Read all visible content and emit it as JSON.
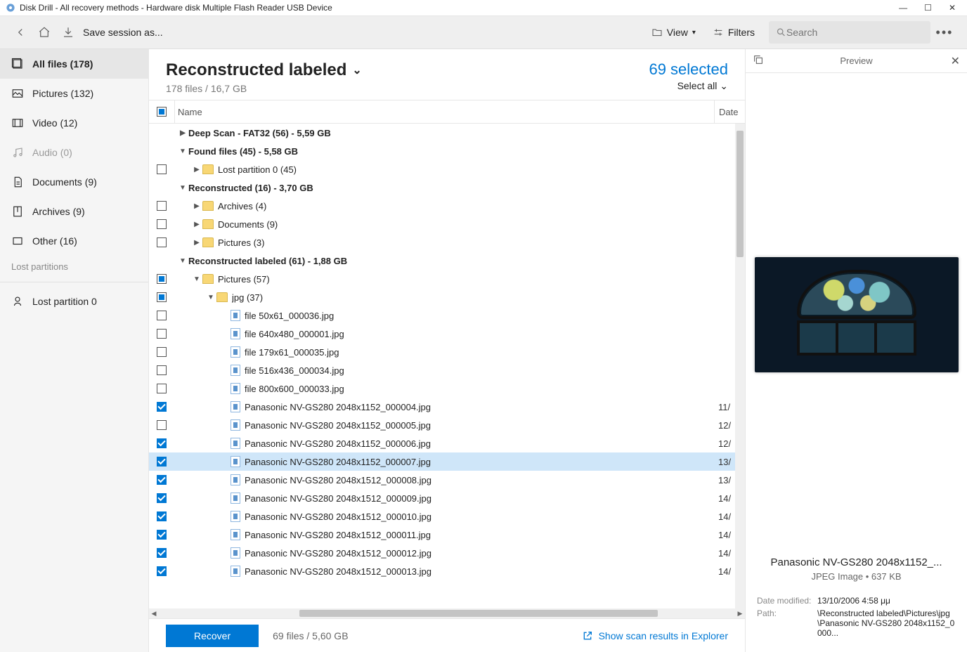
{
  "window": {
    "title": "Disk Drill - All recovery methods - Hardware disk Multiple Flash Reader USB Device"
  },
  "toolbar": {
    "save_session": "Save session as...",
    "view": "View",
    "filters": "Filters",
    "search_placeholder": "Search"
  },
  "sidebar": {
    "items": [
      {
        "label": "All files (178)",
        "active": true
      },
      {
        "label": "Pictures (132)"
      },
      {
        "label": "Video (12)"
      },
      {
        "label": "Audio (0)",
        "muted": true
      },
      {
        "label": "Documents (9)"
      },
      {
        "label": "Archives (9)"
      },
      {
        "label": "Other (16)"
      }
    ],
    "lost_label": "Lost partitions",
    "lost_items": [
      {
        "label": "Lost partition 0"
      }
    ]
  },
  "header": {
    "title": "Reconstructed labeled",
    "subtitle": "178 files / 16,7 GB",
    "selected": "69 selected",
    "select_all": "Select all"
  },
  "columns": {
    "name": "Name",
    "date": "Date"
  },
  "rows": [
    {
      "type": "group",
      "expander": "▶",
      "label": "Deep Scan - FAT32 (56) - 5,59 GB"
    },
    {
      "type": "group",
      "expander": "▼",
      "label": "Found files (45) - 5,58 GB"
    },
    {
      "type": "folder",
      "cb": "empty",
      "indent": 1,
      "expander": "▶",
      "label": "Lost partition 0 (45)"
    },
    {
      "type": "group",
      "expander": "▼",
      "label": "Reconstructed (16) - 3,70 GB"
    },
    {
      "type": "folder",
      "cb": "empty",
      "indent": 1,
      "expander": "▶",
      "label": "Archives (4)"
    },
    {
      "type": "folder",
      "cb": "empty",
      "indent": 1,
      "expander": "▶",
      "label": "Documents (9)"
    },
    {
      "type": "folder",
      "cb": "empty",
      "indent": 1,
      "expander": "▶",
      "label": "Pictures (3)"
    },
    {
      "type": "group",
      "expander": "▼",
      "label": "Reconstructed labeled (61) - 1,88 GB"
    },
    {
      "type": "folder",
      "cb": "partial",
      "indent": 1,
      "expander": "▼",
      "label": "Pictures (57)"
    },
    {
      "type": "folder",
      "cb": "partial",
      "indent": 2,
      "expander": "▼",
      "label": "jpg (37)"
    },
    {
      "type": "file",
      "cb": "empty",
      "indent": 3,
      "label": "file 50x61_000036.jpg"
    },
    {
      "type": "file",
      "cb": "empty",
      "indent": 3,
      "label": "file 640x480_000001.jpg"
    },
    {
      "type": "file",
      "cb": "empty",
      "indent": 3,
      "label": "file 179x61_000035.jpg"
    },
    {
      "type": "file",
      "cb": "empty",
      "indent": 3,
      "label": "file 516x436_000034.jpg"
    },
    {
      "type": "file",
      "cb": "empty",
      "indent": 3,
      "label": "file 800x600_000033.jpg"
    },
    {
      "type": "file",
      "cb": "checked",
      "indent": 3,
      "label": "Panasonic NV-GS280 2048x1152_000004.jpg",
      "date": "11/"
    },
    {
      "type": "file",
      "cb": "empty",
      "indent": 3,
      "label": "Panasonic NV-GS280 2048x1152_000005.jpg",
      "date": "12/"
    },
    {
      "type": "file",
      "cb": "checked",
      "indent": 3,
      "label": "Panasonic NV-GS280 2048x1152_000006.jpg",
      "date": "12/"
    },
    {
      "type": "file",
      "cb": "checked",
      "indent": 3,
      "label": "Panasonic NV-GS280 2048x1152_000007.jpg",
      "date": "13/",
      "selected": true
    },
    {
      "type": "file",
      "cb": "checked",
      "indent": 3,
      "label": "Panasonic NV-GS280 2048x1512_000008.jpg",
      "date": "13/"
    },
    {
      "type": "file",
      "cb": "checked",
      "indent": 3,
      "label": "Panasonic NV-GS280 2048x1512_000009.jpg",
      "date": "14/"
    },
    {
      "type": "file",
      "cb": "checked",
      "indent": 3,
      "label": "Panasonic NV-GS280 2048x1512_000010.jpg",
      "date": "14/"
    },
    {
      "type": "file",
      "cb": "checked",
      "indent": 3,
      "label": "Panasonic NV-GS280 2048x1512_000011.jpg",
      "date": "14/"
    },
    {
      "type": "file",
      "cb": "checked",
      "indent": 3,
      "label": "Panasonic NV-GS280 2048x1512_000012.jpg",
      "date": "14/"
    },
    {
      "type": "file",
      "cb": "checked",
      "indent": 3,
      "label": "Panasonic NV-GS280 2048x1512_000013.jpg",
      "date": "14/"
    }
  ],
  "footer": {
    "recover": "Recover",
    "stats": "69 files / 5,60 GB",
    "explorer": "Show scan results in Explorer"
  },
  "preview": {
    "title": "Preview",
    "filename": "Panasonic NV-GS280 2048x1152_...",
    "filetype": "JPEG Image • 637 KB",
    "meta": [
      {
        "k": "Date modified:",
        "v": "13/10/2006 4:58 μμ"
      },
      {
        "k": "Path:",
        "v": "\\Reconstructed labeled\\Pictures\\jpg\\Panasonic NV-GS280 2048x1152_0000..."
      }
    ]
  }
}
